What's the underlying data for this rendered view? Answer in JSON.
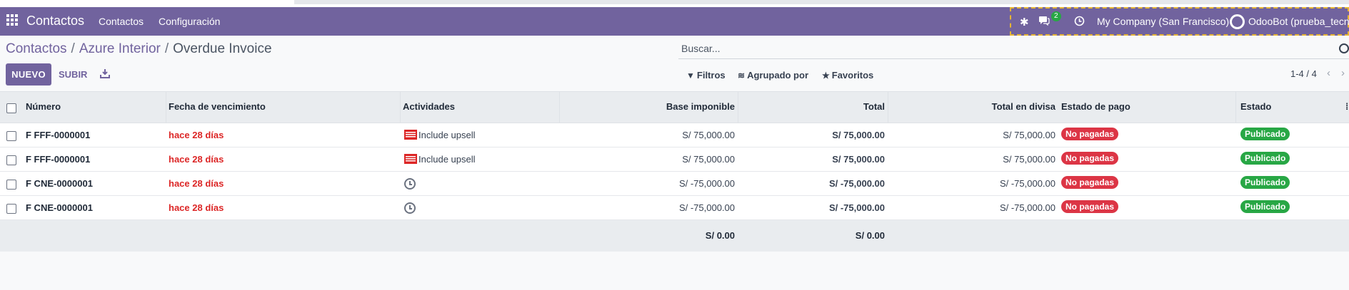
{
  "navbar": {
    "brand": "Contactos",
    "menus": [
      "Contactos",
      "Configuración"
    ],
    "messages_badge": "2",
    "company": "My Company (San Francisco)",
    "user": "OdooBot (prueba_tecnic"
  },
  "breadcrumb": {
    "items": [
      "Contactos",
      "Azure Interior"
    ],
    "separator": "/",
    "current": "Overdue Invoice"
  },
  "search": {
    "placeholder": "Buscar..."
  },
  "toolbar": {
    "new_label": "NUEVO",
    "upload_label": "SUBIR"
  },
  "filters": {
    "filters_label": "Filtros",
    "group_label": "Agrupado por",
    "favorites_label": "Favoritos"
  },
  "pager": {
    "value": "1-4 / 4"
  },
  "table": {
    "columns": [
      "Número",
      "Fecha de vencimiento",
      "Actividades",
      "Base imponible",
      "Total",
      "Total en divisa",
      "Estado de pago",
      "Estado"
    ],
    "rows": [
      {
        "numero": "F FFF-0000001",
        "vencimiento": "hace 28 días",
        "actividad": "Include upsell",
        "base": "S/ 75,000.00",
        "total": "S/ 75,000.00",
        "divisa": "S/ 75,000.00",
        "pago": "No pagadas",
        "estado": "Publicado"
      },
      {
        "numero": "F FFF-0000001",
        "vencimiento": "hace 28 días",
        "actividad": "Include upsell",
        "base": "S/ 75,000.00",
        "total": "S/ 75,000.00",
        "divisa": "S/ 75,000.00",
        "pago": "No pagadas",
        "estado": "Publicado"
      },
      {
        "numero": "F CNE-0000001",
        "vencimiento": "hace 28 días",
        "actividad": "",
        "base": "S/ -75,000.00",
        "total": "S/ -75,000.00",
        "divisa": "S/ -75,000.00",
        "pago": "No pagadas",
        "estado": "Publicado"
      },
      {
        "numero": "F CNE-0000001",
        "vencimiento": "hace 28 días",
        "actividad": "",
        "base": "S/ -75,000.00",
        "total": "S/ -75,000.00",
        "divisa": "S/ -75,000.00",
        "pago": "No pagadas",
        "estado": "Publicado"
      }
    ],
    "footer": {
      "base": "S/ 0.00",
      "total": "S/ 0.00"
    }
  },
  "colors": {
    "brand": "#71639e",
    "overdue": "#dc2626",
    "unpaid": "#dc3545",
    "posted": "#28a745"
  }
}
